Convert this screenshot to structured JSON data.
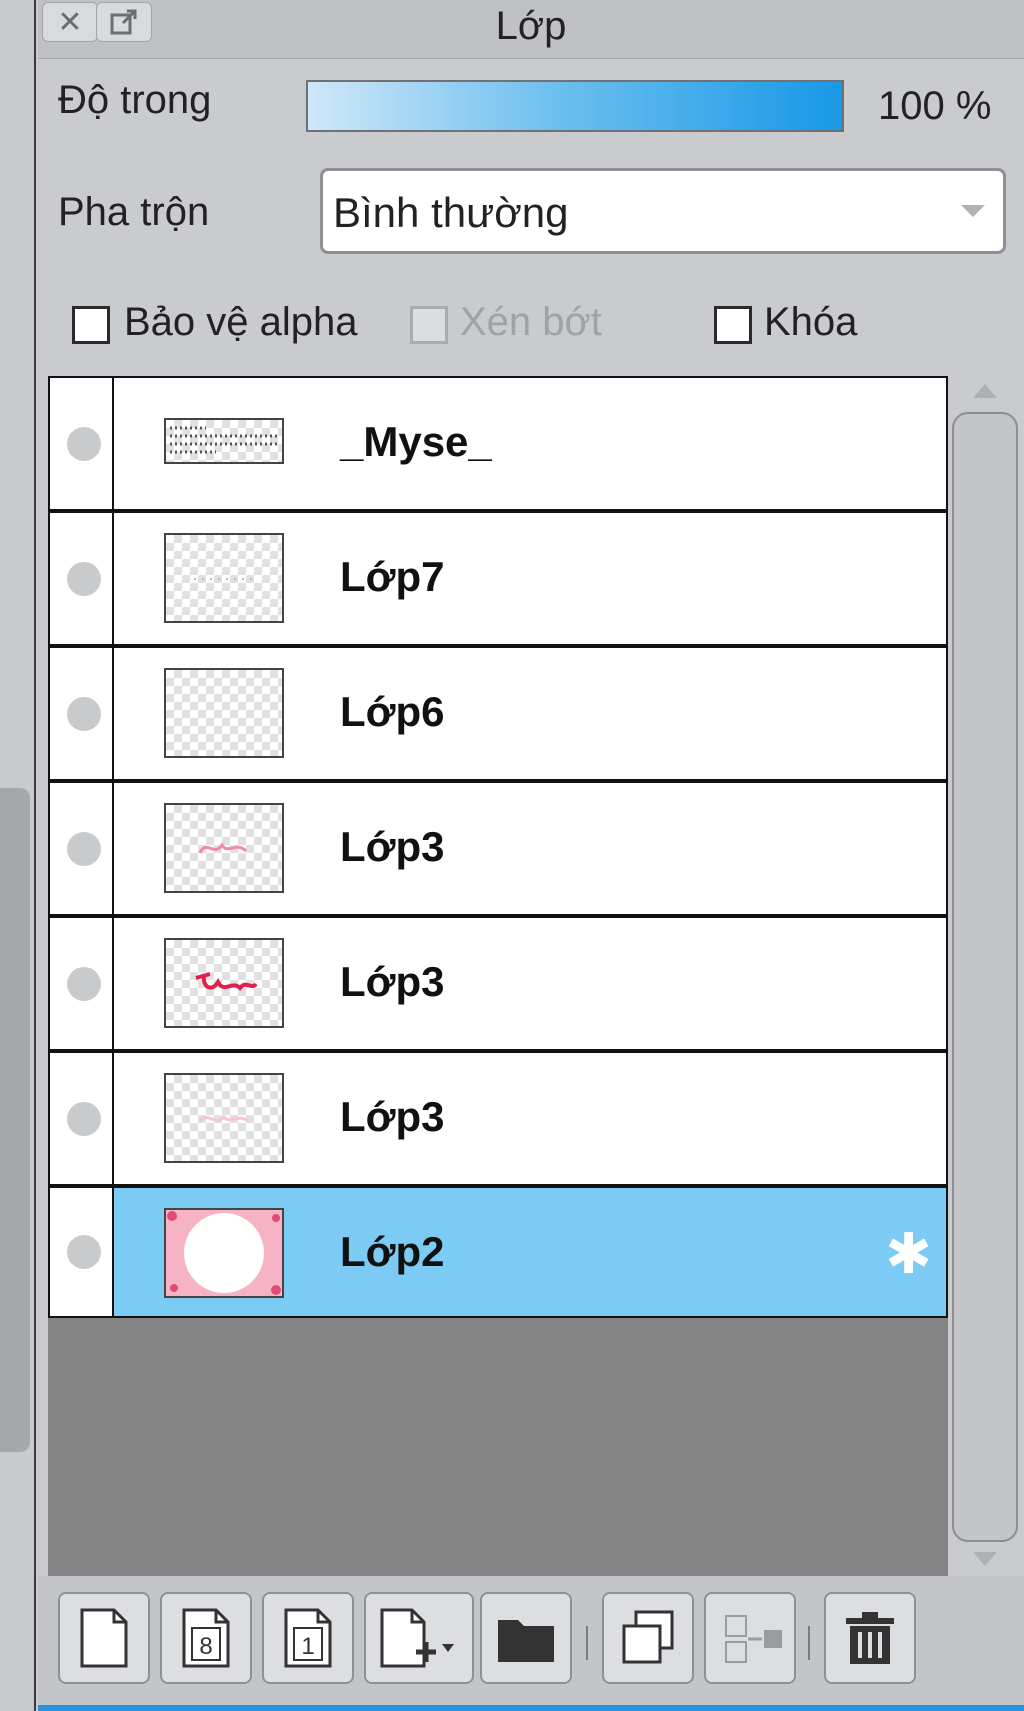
{
  "panel": {
    "title": "Lớp",
    "opacity_label": "Độ trong",
    "opacity_value": "100 %",
    "opacity_fraction": 1.0,
    "blend_label": "Pha trộn",
    "blend_value": "Bình thường",
    "checkboxes": {
      "alpha_protect": "Bảo vệ alpha",
      "clip": "Xén bớt",
      "lock": "Khóa"
    }
  },
  "layers": [
    {
      "name": "_Myse_"
    },
    {
      "name": "Lớp7"
    },
    {
      "name": "Lớp6"
    },
    {
      "name": "Lớp3"
    },
    {
      "name": "Lớp3"
    },
    {
      "name": "Lớp3"
    },
    {
      "name": "Lớp2"
    }
  ],
  "footer": {
    "icons": [
      "new-layer-icon",
      "new-8bit-layer-icon",
      "new-1bit-layer-icon",
      "add-layer-menu-icon",
      "new-folder-icon",
      "duplicate-layer-icon",
      "merge-down-icon",
      "delete-layer-icon"
    ],
    "layer_8_digit": "8",
    "layer_1_digit": "1"
  },
  "colors": {
    "selected": "#7ccbf4",
    "accent": "#1898e6"
  }
}
